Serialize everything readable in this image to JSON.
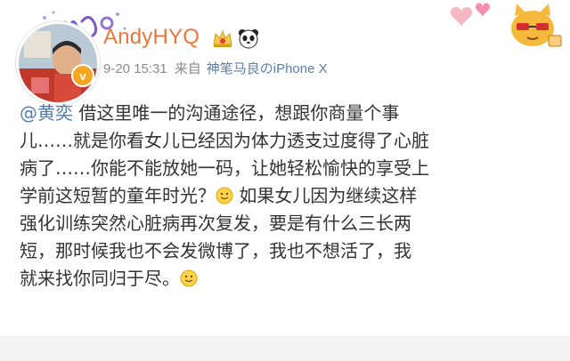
{
  "post": {
    "username": "AndyHYQ",
    "time": "9-20 15:31",
    "from_label": "来自",
    "source": "神笔马良のiPhone X",
    "mention": "@黄奕",
    "line1": " 借这里唯一的沟通途径，想跟你商量个事",
    "line2": "儿……就是你看女儿已经因为体力透支过度得了心脏",
    "line3": "病了……你能不能放她一码，让她轻松愉快的享受上",
    "line4a": "学前这短暂的童年时光？",
    "line4b": " 如果女儿因为继续这样",
    "line5": "强化训练突然心脏病再次复发，要是有什么三长两",
    "line6": "短，那时候我也不会发微博了，我也不想活了，我",
    "line7": "就来找你同归于尽。",
    "verified_mark": "v",
    "emoji_name": "smile-emoji"
  },
  "colors": {
    "username": "#e8793b",
    "mention": "#4f7db3",
    "source": "#5b7fa6",
    "meta": "#8a8a8a",
    "text": "#333333",
    "verified": "#f5a623"
  }
}
